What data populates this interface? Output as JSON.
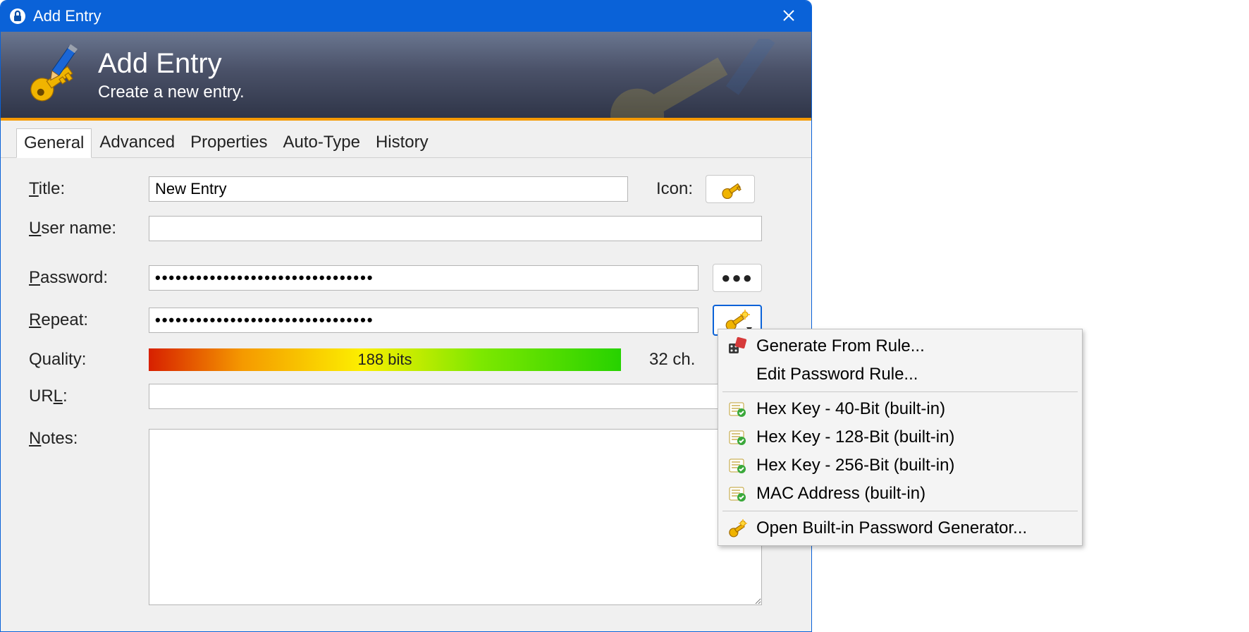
{
  "window": {
    "title": "Add Entry"
  },
  "header": {
    "title": "Add Entry",
    "subtitle": "Create a new entry."
  },
  "tabs": {
    "general": "General",
    "advanced": "Advanced",
    "properties": "Properties",
    "autotype": "Auto-Type",
    "history": "History"
  },
  "form": {
    "title_label_pre": "T",
    "title_label_rest": "itle:",
    "title_value": "New Entry",
    "icon_label_pre": "I",
    "icon_label_rest": "con:",
    "username_label_pre": "U",
    "username_label_rest": "ser name:",
    "username_value": "",
    "password_label_pre": "P",
    "password_label_rest": "assword:",
    "password_value": "••••••••••••••••••••••••••••••••",
    "repeat_label_pre": "R",
    "repeat_label_rest": "epeat:",
    "repeat_value": "••••••••••••••••••••••••••••••••",
    "reveal_dots": "●●●",
    "quality_label": "Quality:",
    "quality_bits": "188 bits",
    "quality_chars": "32 ch.",
    "url_label_pre": "UR",
    "url_label_under": "L",
    "url_label_rest": ":",
    "url_value": "",
    "notes_label_pre": "N",
    "notes_label_rest": "otes:"
  },
  "menu": {
    "generate_rule": "Generate From Rule...",
    "edit_rule": "Edit Password Rule...",
    "hex40": "Hex Key - 40-Bit (built-in)",
    "hex128": "Hex Key - 128-Bit (built-in)",
    "hex256": "Hex Key - 256-Bit (built-in)",
    "mac": "MAC Address (built-in)",
    "open_gen": "Open Built-in Password Generator..."
  }
}
